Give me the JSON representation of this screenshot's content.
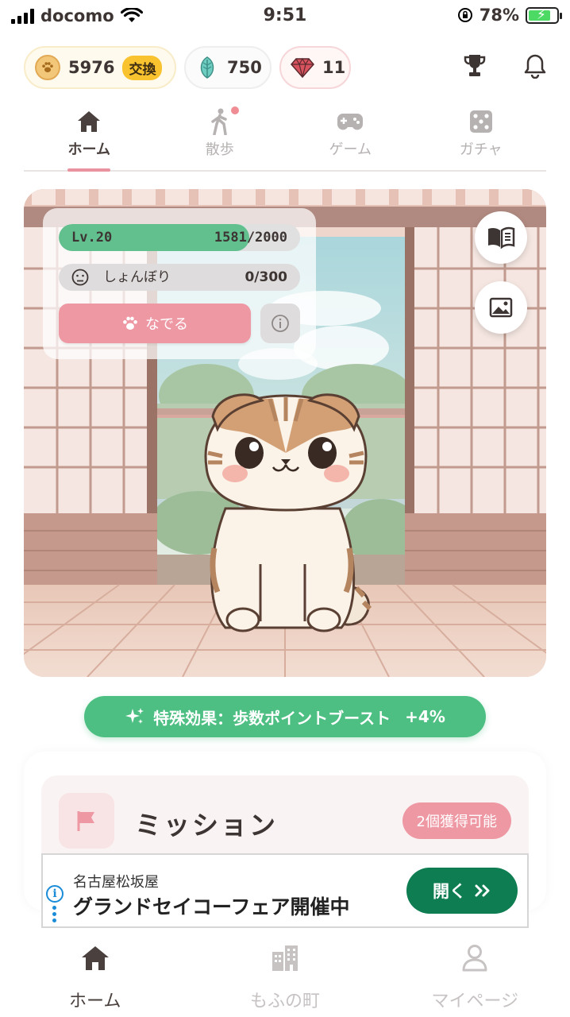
{
  "status_bar": {
    "carrier": "docomo",
    "time": "9:51",
    "battery_percent": "78%",
    "battery_level": 0.78
  },
  "currencies": {
    "coins": {
      "value": "5976",
      "exchange_label": "交換",
      "icon": "paw-coin-icon"
    },
    "leaves": {
      "value": "750",
      "icon": "leaf-icon"
    },
    "gems": {
      "value": "11",
      "icon": "gem-icon"
    }
  },
  "header_icons": [
    "trophy-icon",
    "bell-icon"
  ],
  "tabs": [
    {
      "label": "ホーム",
      "icon": "home-icon",
      "active": true
    },
    {
      "label": "散歩",
      "icon": "walking-icon",
      "active": false,
      "notification_dot": true
    },
    {
      "label": "ゲーム",
      "icon": "gamepad-icon",
      "active": false
    },
    {
      "label": "ガチャ",
      "icon": "dice-icon",
      "active": false
    }
  ],
  "pet_status": {
    "level_label": "Lv.20",
    "xp_text": "1581/2000",
    "xp_fraction": 0.79,
    "mood_label": "しょんぼり",
    "mood_value": "0/300",
    "pet_button_label": "なでる"
  },
  "scene_buttons": [
    "book-icon",
    "photo-icon"
  ],
  "effect_badge": {
    "text": "特殊効果：歩数ポイントブースト",
    "value": "+4%",
    "color": "#4ebf83"
  },
  "mission": {
    "title": "ミッション",
    "badge": "2個獲得可能"
  },
  "ad": {
    "advertiser": "名古屋松坂屋",
    "headline": "グランドセイコーフェア開催中",
    "cta": "開く"
  },
  "bottom_nav": [
    {
      "label": "ホーム",
      "icon": "home-icon",
      "active": true
    },
    {
      "label": "もふの町",
      "icon": "buildings-icon",
      "active": false
    },
    {
      "label": "マイページ",
      "icon": "person-icon",
      "active": false
    }
  ],
  "colors": {
    "accent_pink": "#ee98a4",
    "accent_green": "#62c08f",
    "ad_green": "#0f7d52"
  }
}
